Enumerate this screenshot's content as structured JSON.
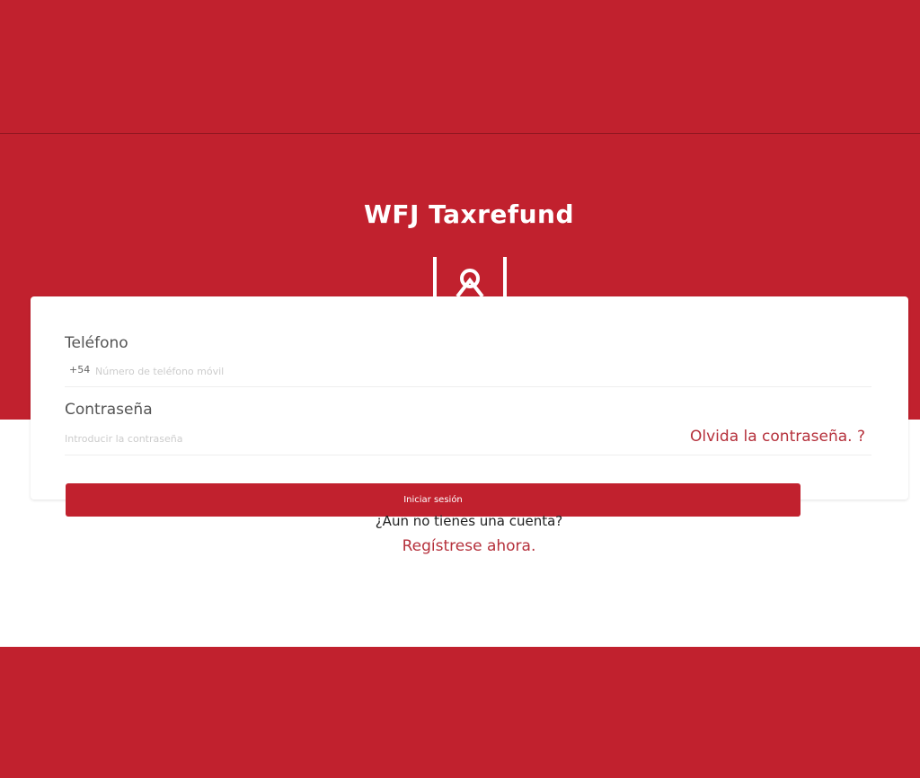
{
  "header": {
    "title": "WFJ Taxrefund",
    "logo_icon": "logo-icon"
  },
  "form": {
    "phone_label": "Teléfono",
    "country_code": "+54",
    "phone_placeholder": "Número de teléfono móvil",
    "password_label": "Contraseña",
    "password_placeholder": "Introducir la contraseña",
    "forgot_label": "Olvida la contraseña. ?",
    "login_label": "Iniciar sesión"
  },
  "footer": {
    "no_account_text": "¿Aun no tienes una cuenta?",
    "register_label": "Regístrese ahora."
  },
  "colors": {
    "brand": "#c1212e",
    "link": "#b5303b"
  }
}
